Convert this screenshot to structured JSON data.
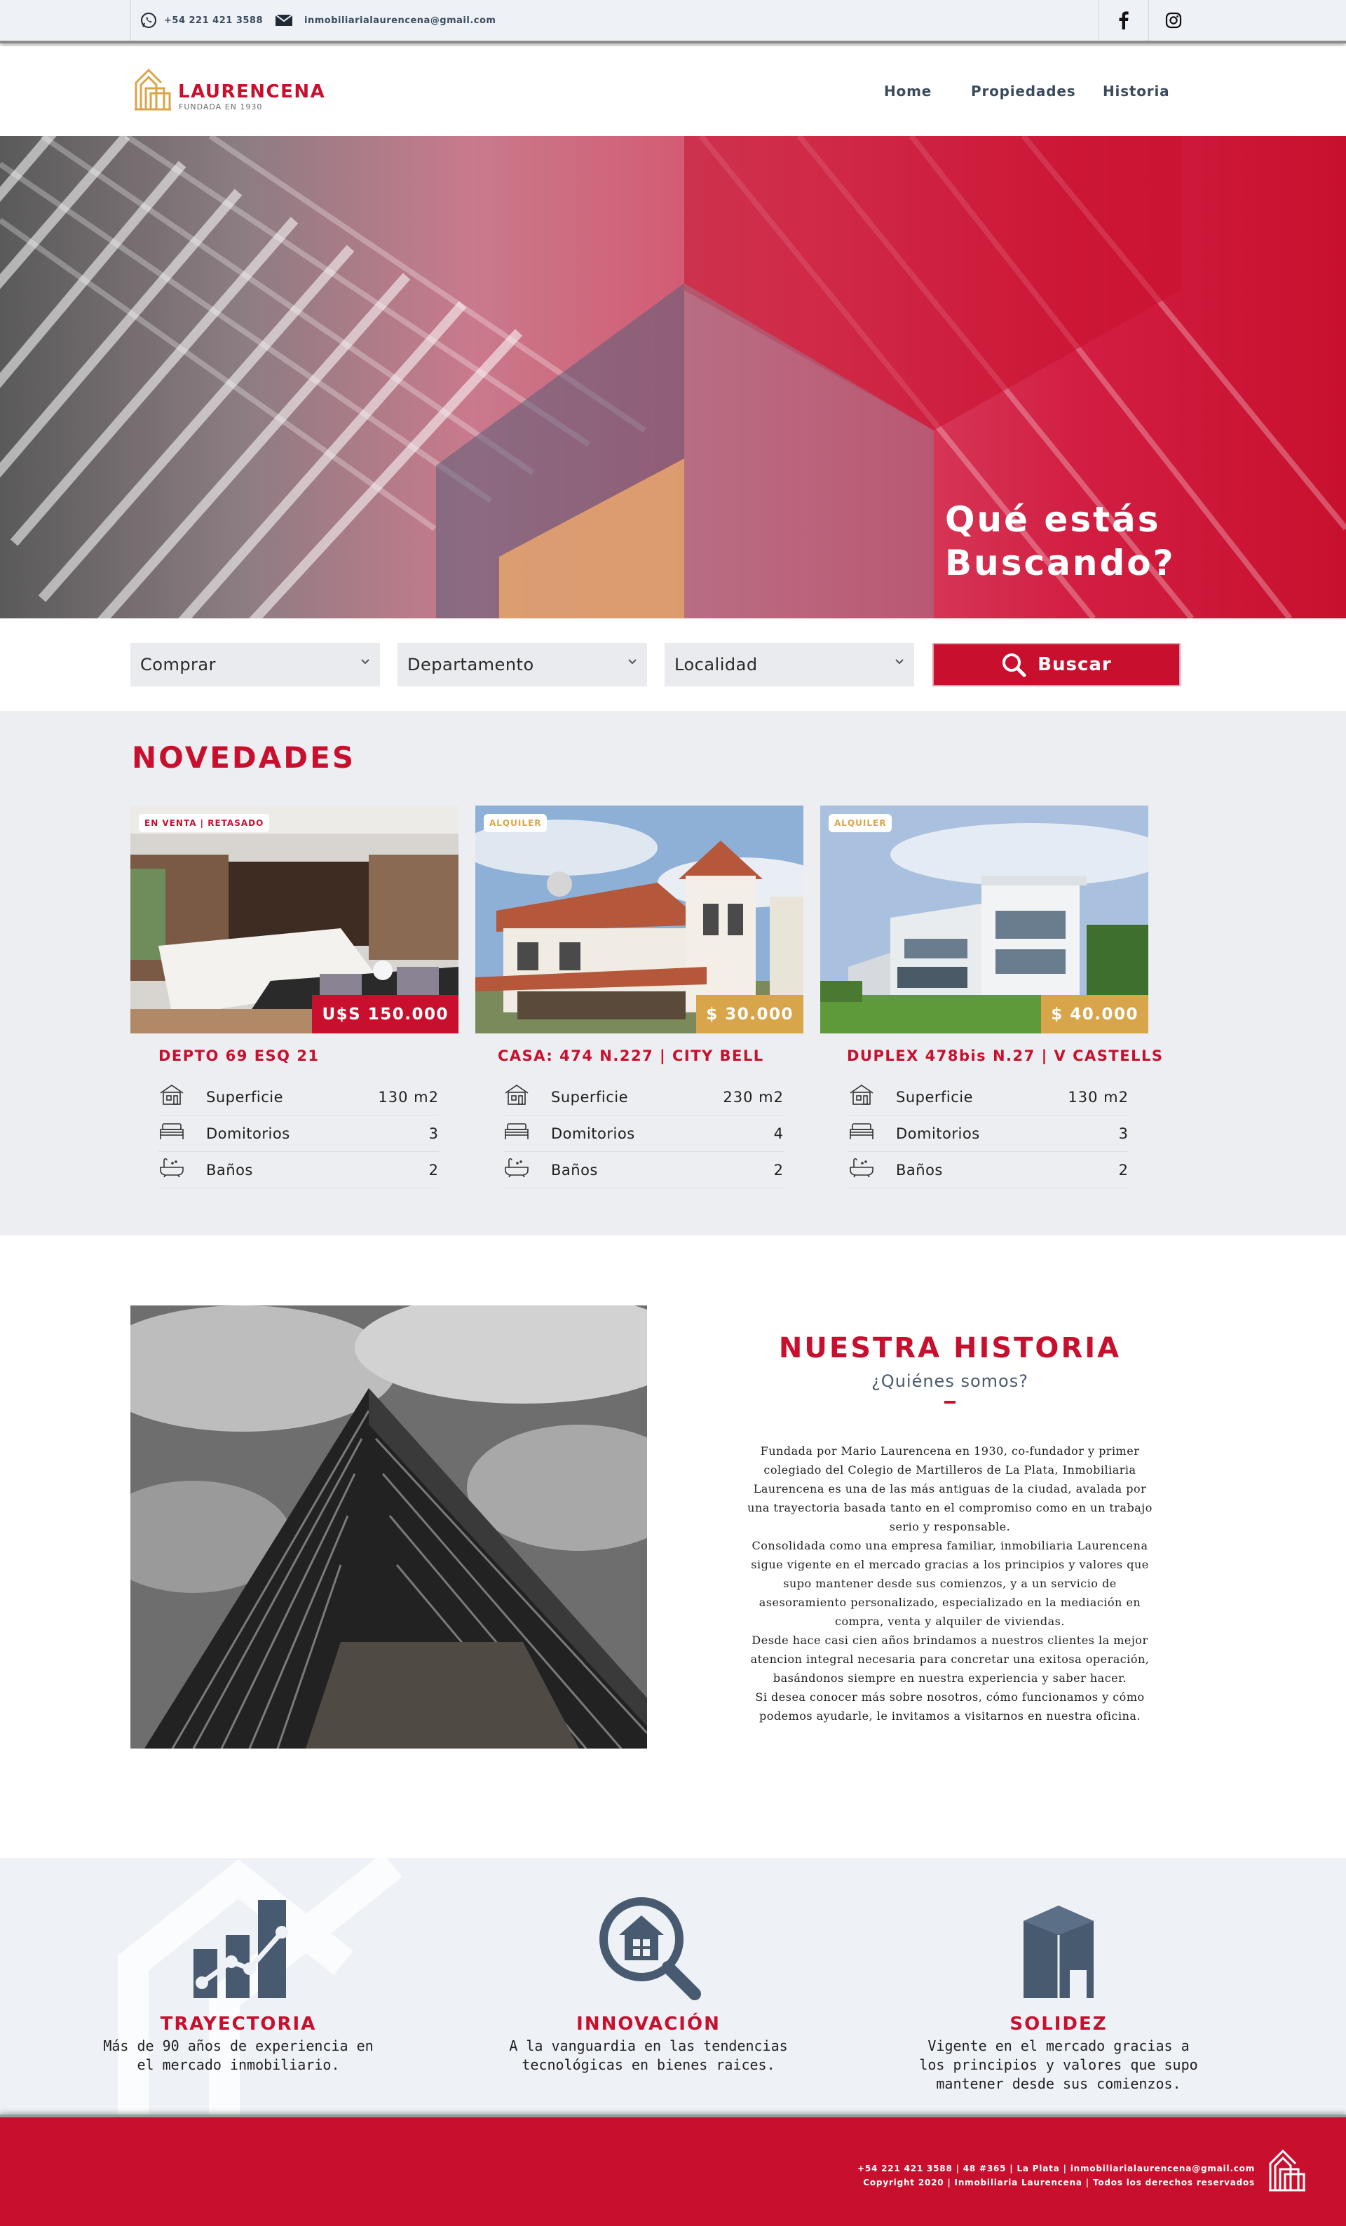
{
  "topbar": {
    "phone": "+54 221 421 3588",
    "email": "inmobiliarialaurencena@gmail.com"
  },
  "header": {
    "logo_name": "LAURENCENA",
    "logo_sub": "FUNDADA EN 1930",
    "nav": [
      "Home",
      "Propiedades",
      "Historia"
    ]
  },
  "hero": {
    "title_line1": "Qué estás",
    "title_line2": "Buscando?"
  },
  "search": {
    "operation": "Comprar",
    "type": "Departamento",
    "location": "Localidad",
    "button": "Buscar"
  },
  "novedades": {
    "title": "NOVEDADES",
    "cards": [
      {
        "badge": "EN VENTA | RETASADO",
        "price": "U$S 150.000",
        "title": "DEPTO 69 ESQ 21",
        "specs": [
          {
            "label": "Superficie",
            "value": "130 m2"
          },
          {
            "label": "Domitorios",
            "value": "3"
          },
          {
            "label": "Baños",
            "value": "2"
          }
        ]
      },
      {
        "badge": "ALQUILER",
        "price": "$ 30.000",
        "title": "CASA: 474 N.227 | CITY BELL",
        "specs": [
          {
            "label": "Superficie",
            "value": "230 m2"
          },
          {
            "label": "Domitorios",
            "value": "4"
          },
          {
            "label": "Baños",
            "value": "2"
          }
        ]
      },
      {
        "badge": "ALQUILER",
        "price": "$ 40.000",
        "title": "DUPLEX 478bis N.27 | V CASTELLS",
        "specs": [
          {
            "label": "Superficie",
            "value": "130 m2"
          },
          {
            "label": "Domitorios",
            "value": "3"
          },
          {
            "label": "Baños",
            "value": "2"
          }
        ]
      }
    ]
  },
  "historia": {
    "title": "NUESTRA HISTORIA",
    "subtitle": "¿Quiénes somos?",
    "paragraphs": [
      "Fundada por Mario Laurencena en 1930, co-fundador y primer colegiado del Colegio de Martilleros de La Plata, Inmobiliaria Laurencena es una de las más antiguas de la ciudad, avalada por una trayectoria basada tanto en el compromiso como en un trabajo serio y responsable.",
      "Consolidada como una empresa familiar, inmobiliaria Laurencena sigue vigente en el mercado gracias a los principios y valores que supo mantener desde sus comienzos, y a un servicio de asesoramiento personalizado, especializado en la mediación en compra, venta y alquiler de viviendas.",
      "Desde hace casi cien años brindamos a nuestros clientes la mejor atencion integral necesaria para concretar una exitosa operación, basándonos siempre en nuestra experiencia y saber hacer.",
      "Si desea conocer más sobre nosotros, cómo funcionamos y cómo podemos ayudarle, le invitamos a visitarnos en nuestra oficina."
    ]
  },
  "valores": [
    {
      "title": "TRAYECTORIA",
      "desc": "Más de 90 años de experiencia en el mercado inmobiliario."
    },
    {
      "title": "INNOVACIÓN",
      "desc": "A la vanguardia en las tendencias tecnológicas en bienes raices."
    },
    {
      "title": "SOLIDEZ",
      "desc": "Vigente en el mercado gracias a los principios y valores que supo mantener desde sus comienzos."
    }
  ],
  "footer": {
    "contact_line": "+54 221 421 3588  |  48 #365  |  La Plata  |  inmobiliarialaurencena@gmail.com",
    "copyright": "Copyright 2020 | Inmobiliaria Laurencena | Todos los derechos reservados"
  },
  "colors": {
    "brand_red": "#c8102e",
    "gold": "#d9a54a",
    "slate": "#3b4a5c",
    "icon_slate": "#475a70"
  },
  "icons": [
    "whatsapp-icon",
    "mail-icon",
    "facebook-icon",
    "instagram-icon",
    "search-icon",
    "house-icon",
    "bed-icon",
    "bathtub-icon",
    "growth-chart-icon",
    "house-magnifier-icon",
    "buildings-icon",
    "logo-mark-icon"
  ]
}
